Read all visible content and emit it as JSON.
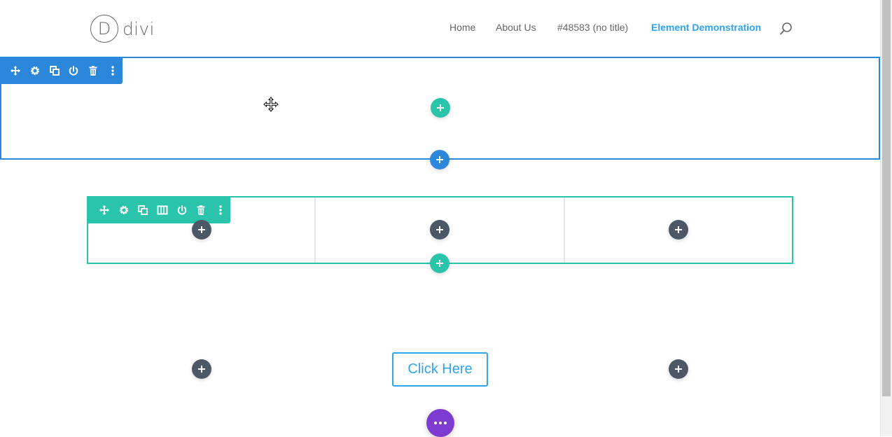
{
  "header": {
    "logo_letter": "D",
    "logo_text": "divi",
    "nav": [
      {
        "label": "Home"
      },
      {
        "label": "About Us"
      },
      {
        "label": "#48583 (no title)"
      },
      {
        "label": "Element Demonstration"
      }
    ],
    "search_icon": "search-icon"
  },
  "section_toolbar": {
    "icons": [
      "move-icon",
      "gear-icon",
      "duplicate-icon",
      "power-icon",
      "trash-icon",
      "more-icon"
    ]
  },
  "row_toolbar": {
    "icons": [
      "move-icon",
      "gear-icon",
      "duplicate-icon",
      "columns-icon",
      "power-icon",
      "trash-icon",
      "more-icon"
    ]
  },
  "content": {
    "button_label": "Click Here"
  },
  "colors": {
    "section_blue": "#2b87da",
    "row_teal": "#29c4a9",
    "module_dark": "#4c5866",
    "page_purple": "#7e3bd0",
    "link_blue": "#2ea3f2"
  }
}
